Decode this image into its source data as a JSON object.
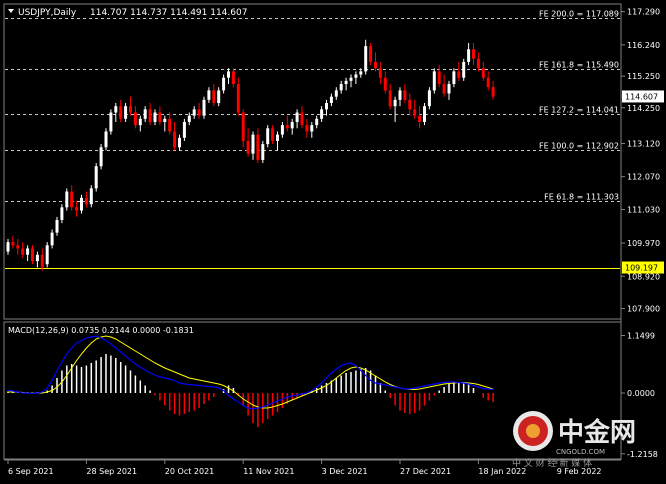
{
  "header": {
    "symbol": "USDJPY,Daily",
    "ohlc": "114.707 114.737 114.491 114.607"
  },
  "macd": {
    "label": "MACD(12,26,9) 0.0735 0.2144 0.0000 -0.1831"
  },
  "watermark": {
    "brand": "中金网",
    "site": "CNGOLD.COM",
    "slogan": "中 文 财 经 新 媒 体"
  },
  "colors": {
    "background": "#000000",
    "bull_candle": "#ffffff",
    "bear_candle": "#ff0000",
    "fib_line": "#c8c8c8",
    "support_line": "#ffff00",
    "macd_line": "#0000ff",
    "signal_line": "#ffff00",
    "hist_pos": "#ffffff",
    "hist_neg": "#ff0000"
  },
  "chart_data": [
    {
      "type": "candlestick",
      "title": "USDJPY,Daily",
      "ylim": [
        107.6,
        117.5
      ],
      "y_ticks": [
        117.29,
        116.24,
        115.25,
        114.25,
        113.12,
        112.07,
        111.03,
        109.97,
        108.92,
        107.9
      ],
      "x_labels": [
        {
          "label": "6 Sep 2021",
          "index": 0
        },
        {
          "label": "28 Sep 2021",
          "index": 16
        },
        {
          "label": "20 Oct 2021",
          "index": 32
        },
        {
          "label": "11 Nov 2021",
          "index": 48
        },
        {
          "label": "3 Dec 2021",
          "index": 64
        },
        {
          "label": "27 Dec 2021",
          "index": 80
        },
        {
          "label": "18 Jan 2022",
          "index": 96
        },
        {
          "label": "9 Feb 2022",
          "index": 112
        }
      ],
      "current_price": "114.607",
      "support_price": "109.197",
      "fib_levels": [
        {
          "label": "FE 200.0 = 117.089",
          "value": 117.089
        },
        {
          "label": "FE 161.8 = 115.490",
          "value": 115.49
        },
        {
          "label": "FE 127.2 = 114.041",
          "value": 114.041
        },
        {
          "label": "FE 100.0 = 112.902",
          "value": 112.902
        },
        {
          "label": "FE 61.8 = 111.303",
          "value": 111.303
        }
      ],
      "horizontal_line": 109.197,
      "candles": [
        [
          109.7,
          110.1,
          109.6,
          110.0
        ],
        [
          110.0,
          110.2,
          109.8,
          109.9
        ],
        [
          109.9,
          110.1,
          109.6,
          109.8
        ],
        [
          109.8,
          110.0,
          109.5,
          109.6
        ],
        [
          109.6,
          109.9,
          109.4,
          109.8
        ],
        [
          109.8,
          109.9,
          109.3,
          109.4
        ],
        [
          109.4,
          109.7,
          109.2,
          109.6
        ],
        [
          109.6,
          109.8,
          109.1,
          109.2
        ],
        [
          109.3,
          110.0,
          109.2,
          109.9
        ],
        [
          109.9,
          110.4,
          109.8,
          110.3
        ],
        [
          110.3,
          110.8,
          110.2,
          110.7
        ],
        [
          110.7,
          111.2,
          110.6,
          111.1
        ],
        [
          111.1,
          111.7,
          111.0,
          111.6
        ],
        [
          111.6,
          111.8,
          111.0,
          111.1
        ],
        [
          111.1,
          111.3,
          110.8,
          111.0
        ],
        [
          111.0,
          111.5,
          110.9,
          111.4
        ],
        [
          111.4,
          111.6,
          111.1,
          111.2
        ],
        [
          111.2,
          111.8,
          111.1,
          111.7
        ],
        [
          111.7,
          112.5,
          111.6,
          112.4
        ],
        [
          112.4,
          113.1,
          112.3,
          113.0
        ],
        [
          113.0,
          113.6,
          112.9,
          113.5
        ],
        [
          113.5,
          114.2,
          113.4,
          114.1
        ],
        [
          114.1,
          114.4,
          113.8,
          114.3
        ],
        [
          114.3,
          114.5,
          113.8,
          113.9
        ],
        [
          113.9,
          114.4,
          113.8,
          114.3
        ],
        [
          114.3,
          114.6,
          114.0,
          114.1
        ],
        [
          114.1,
          114.3,
          113.6,
          113.7
        ],
        [
          113.7,
          114.0,
          113.5,
          113.9
        ],
        [
          113.9,
          114.3,
          113.8,
          114.2
        ],
        [
          114.2,
          114.4,
          113.7,
          113.8
        ],
        [
          113.8,
          114.2,
          113.7,
          114.1
        ],
        [
          114.1,
          114.3,
          113.7,
          113.8
        ],
        [
          113.8,
          114.0,
          113.5,
          113.9
        ],
        [
          113.9,
          114.1,
          113.4,
          113.5
        ],
        [
          113.5,
          113.8,
          112.9,
          113.0
        ],
        [
          113.0,
          113.4,
          112.9,
          113.3
        ],
        [
          113.3,
          113.9,
          113.2,
          113.8
        ],
        [
          113.8,
          114.1,
          113.7,
          114.0
        ],
        [
          114.0,
          114.3,
          113.9,
          114.2
        ],
        [
          114.2,
          114.4,
          113.9,
          114.0
        ],
        [
          114.0,
          114.6,
          113.9,
          114.5
        ],
        [
          114.5,
          114.9,
          114.4,
          114.8
        ],
        [
          114.8,
          115.0,
          114.3,
          114.4
        ],
        [
          114.4,
          114.9,
          114.3,
          114.8
        ],
        [
          114.8,
          115.3,
          114.7,
          115.2
        ],
        [
          115.2,
          115.5,
          115.0,
          115.4
        ],
        [
          115.4,
          115.5,
          114.9,
          115.0
        ],
        [
          115.0,
          115.2,
          114.0,
          114.1
        ],
        [
          114.1,
          114.2,
          113.0,
          113.2
        ],
        [
          113.2,
          113.6,
          112.7,
          112.8
        ],
        [
          112.8,
          113.5,
          112.6,
          113.4
        ],
        [
          113.4,
          113.6,
          112.5,
          112.6
        ],
        [
          112.6,
          113.2,
          112.5,
          113.1
        ],
        [
          113.1,
          113.7,
          113.0,
          113.6
        ],
        [
          113.6,
          113.7,
          113.1,
          113.2
        ],
        [
          113.2,
          113.5,
          112.9,
          113.4
        ],
        [
          113.4,
          113.8,
          113.3,
          113.7
        ],
        [
          113.7,
          114.0,
          113.5,
          113.6
        ],
        [
          113.6,
          113.9,
          113.4,
          113.8
        ],
        [
          113.8,
          114.2,
          113.6,
          114.1
        ],
        [
          114.1,
          114.3,
          113.6,
          113.7
        ],
        [
          113.7,
          113.9,
          113.3,
          113.5
        ],
        [
          113.5,
          113.8,
          113.3,
          113.7
        ],
        [
          113.7,
          114.0,
          113.6,
          113.9
        ],
        [
          113.9,
          114.3,
          113.8,
          114.2
        ],
        [
          114.2,
          114.5,
          114.0,
          114.4
        ],
        [
          114.4,
          114.7,
          114.3,
          114.6
        ],
        [
          114.6,
          114.9,
          114.5,
          114.8
        ],
        [
          114.8,
          115.1,
          114.7,
          115.0
        ],
        [
          115.0,
          115.2,
          114.8,
          115.1
        ],
        [
          115.1,
          115.3,
          114.9,
          115.2
        ],
        [
          115.2,
          115.4,
          115.0,
          115.3
        ],
        [
          115.3,
          115.5,
          115.2,
          115.4
        ],
        [
          115.4,
          116.4,
          115.3,
          116.2
        ],
        [
          116.2,
          116.3,
          115.6,
          115.7
        ],
        [
          115.7,
          116.0,
          115.4,
          115.5
        ],
        [
          115.5,
          115.7,
          115.0,
          115.2
        ],
        [
          115.2,
          115.4,
          114.7,
          114.8
        ],
        [
          114.8,
          115.0,
          114.2,
          114.3
        ],
        [
          114.3,
          114.6,
          113.8,
          114.5
        ],
        [
          114.5,
          114.9,
          114.3,
          114.8
        ],
        [
          114.8,
          115.0,
          114.4,
          114.5
        ],
        [
          114.5,
          114.7,
          114.0,
          114.2
        ],
        [
          114.2,
          114.5,
          113.9,
          114.0
        ],
        [
          114.0,
          114.3,
          113.6,
          113.8
        ],
        [
          113.8,
          114.4,
          113.7,
          114.3
        ],
        [
          114.3,
          114.9,
          114.2,
          114.8
        ],
        [
          114.8,
          115.5,
          114.7,
          115.4
        ],
        [
          115.4,
          115.6,
          114.9,
          115.0
        ],
        [
          115.0,
          115.3,
          114.6,
          114.7
        ],
        [
          114.7,
          115.1,
          114.5,
          115.0
        ],
        [
          115.0,
          115.5,
          114.9,
          115.4
        ],
        [
          115.4,
          115.7,
          115.1,
          115.2
        ],
        [
          115.2,
          115.8,
          115.1,
          115.7
        ],
        [
          115.7,
          116.3,
          115.6,
          116.1
        ],
        [
          116.1,
          116.3,
          115.6,
          115.8
        ],
        [
          115.8,
          116.0,
          115.4,
          115.5
        ],
        [
          115.5,
          115.7,
          115.1,
          115.2
        ],
        [
          115.2,
          115.4,
          114.8,
          114.9
        ],
        [
          114.9,
          115.1,
          114.5,
          114.6
        ]
      ]
    },
    {
      "type": "macd",
      "title": "MACD(12,26,9)",
      "ylim": [
        -1.3,
        1.18
      ],
      "y_ticks": [
        1.1499,
        0.0,
        -1.2158
      ],
      "histogram": [
        0.03,
        0.04,
        0.03,
        0.02,
        0.02,
        0.01,
        0.02,
        0.0,
        0.05,
        0.15,
        0.3,
        0.45,
        0.55,
        0.58,
        0.55,
        0.52,
        0.55,
        0.6,
        0.65,
        0.72,
        0.78,
        0.75,
        0.7,
        0.62,
        0.55,
        0.45,
        0.35,
        0.25,
        0.15,
        0.05,
        -0.05,
        -0.15,
        -0.25,
        -0.35,
        -0.42,
        -0.45,
        -0.42,
        -0.38,
        -0.35,
        -0.3,
        -0.22,
        -0.15,
        -0.08,
        0.0,
        0.08,
        0.15,
        0.1,
        -0.05,
        -0.25,
        -0.45,
        -0.6,
        -0.68,
        -0.6,
        -0.52,
        -0.45,
        -0.38,
        -0.3,
        -0.22,
        -0.15,
        -0.1,
        -0.05,
        0.0,
        0.05,
        0.1,
        0.15,
        0.2,
        0.25,
        0.3,
        0.35,
        0.4,
        0.42,
        0.45,
        0.48,
        0.5,
        0.45,
        0.35,
        0.2,
        0.05,
        -0.1,
        -0.25,
        -0.35,
        -0.4,
        -0.42,
        -0.4,
        -0.35,
        -0.25,
        -0.15,
        -0.05,
        0.05,
        0.12,
        0.18,
        0.2,
        0.22,
        0.2,
        0.18,
        0.1,
        0.0,
        -0.1,
        -0.15,
        -0.18
      ],
      "macd": [
        0.05,
        0.04,
        0.02,
        0.0,
        0.0,
        -0.01,
        0.0,
        0.02,
        0.1,
        0.25,
        0.45,
        0.62,
        0.78,
        0.9,
        1.0,
        1.05,
        1.1,
        1.12,
        1.14,
        1.1,
        1.05,
        0.98,
        0.9,
        0.82,
        0.74,
        0.66,
        0.58,
        0.52,
        0.46,
        0.4,
        0.36,
        0.32,
        0.3,
        0.28,
        0.25,
        0.2,
        0.18,
        0.17,
        0.16,
        0.15,
        0.14,
        0.13,
        0.12,
        0.1,
        0.05,
        -0.05,
        -0.12,
        -0.18,
        -0.25,
        -0.3,
        -0.32,
        -0.3,
        -0.28,
        -0.24,
        -0.2,
        -0.16,
        -0.12,
        -0.08,
        -0.06,
        -0.04,
        -0.02,
        0.0,
        0.05,
        0.12,
        0.2,
        0.3,
        0.4,
        0.48,
        0.55,
        0.58,
        0.6,
        0.55,
        0.45,
        0.35,
        0.25,
        0.2,
        0.18,
        0.16,
        0.14,
        0.12,
        0.1,
        0.08,
        0.08,
        0.1,
        0.12,
        0.14,
        0.16,
        0.18,
        0.2,
        0.21,
        0.22,
        0.22,
        0.21,
        0.2,
        0.18,
        0.15,
        0.12,
        0.09,
        0.08,
        0.07
      ],
      "signal": [
        0.02,
        0.02,
        0.02,
        0.01,
        0.0,
        0.0,
        0.0,
        0.0,
        0.02,
        0.05,
        0.12,
        0.22,
        0.35,
        0.5,
        0.65,
        0.78,
        0.9,
        1.0,
        1.08,
        1.12,
        1.14,
        1.12,
        1.08,
        1.02,
        0.96,
        0.9,
        0.84,
        0.78,
        0.72,
        0.66,
        0.6,
        0.55,
        0.5,
        0.46,
        0.42,
        0.38,
        0.34,
        0.3,
        0.28,
        0.26,
        0.24,
        0.22,
        0.2,
        0.18,
        0.15,
        0.1,
        0.04,
        -0.04,
        -0.12,
        -0.18,
        -0.24,
        -0.28,
        -0.3,
        -0.3,
        -0.28,
        -0.25,
        -0.22,
        -0.18,
        -0.14,
        -0.1,
        -0.06,
        -0.02,
        0.02,
        0.06,
        0.1,
        0.15,
        0.22,
        0.3,
        0.38,
        0.45,
        0.5,
        0.52,
        0.5,
        0.46,
        0.4,
        0.34,
        0.28,
        0.22,
        0.17,
        0.13,
        0.1,
        0.08,
        0.07,
        0.07,
        0.08,
        0.1,
        0.12,
        0.14,
        0.16,
        0.18,
        0.19,
        0.2,
        0.21,
        0.21,
        0.2,
        0.19,
        0.17,
        0.14,
        0.11,
        0.08
      ]
    }
  ]
}
